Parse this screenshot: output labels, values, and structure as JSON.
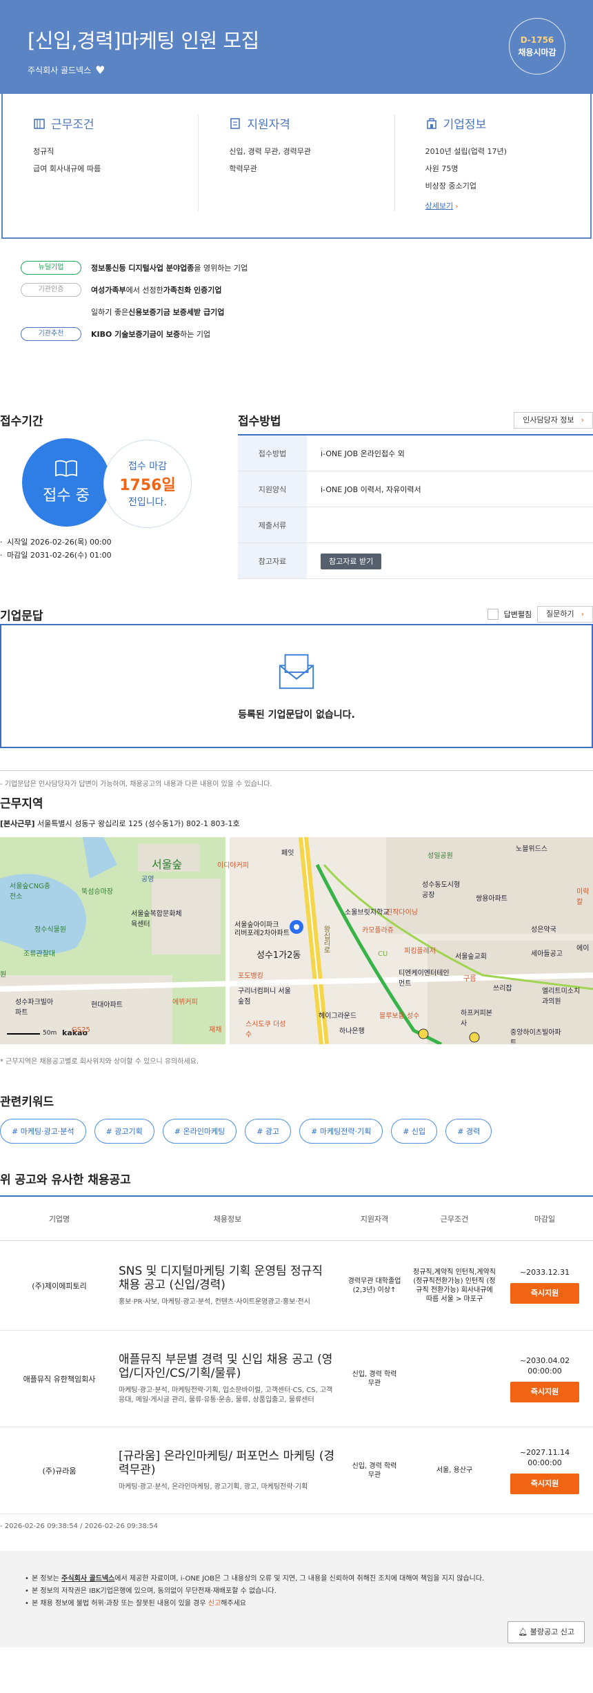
{
  "header": {
    "title": "[신입,경력]마케팅 인원 모집",
    "company": "주식회사 골드넥스",
    "dday": "D-1756",
    "dday_label": "채용시마감"
  },
  "info": {
    "conditions": {
      "title": "근무조건",
      "lines": [
        "정규직",
        "급여 회사내규에 따름"
      ]
    },
    "qualifications": {
      "title": "지원자격",
      "lines": [
        "신입, 경력 무관, 경력무관",
        "학력무관"
      ]
    },
    "company": {
      "title": "기업정보",
      "lines": [
        "2010년 설립(업력 17년)",
        "사원 75명",
        "비상장 중소기업"
      ],
      "link": "상세보기"
    }
  },
  "tags": [
    {
      "pill": "뉴딜기업",
      "bold": "정보통신등 디지털사업 분야업종",
      "rest": "을 영위하는 기업"
    },
    {
      "pill": "기관인증",
      "bold": "여성가족부",
      "mid": "에서 선정한 ",
      "bold2": "가족친화 인증기업"
    },
    {
      "pill": "",
      "pre": "일하기 좋은 ",
      "bold": "신용보증기금 보증세받 급기업"
    },
    {
      "pill": "기관추천",
      "bold": "KIBO 기술보증기금이 보증",
      "rest": "하는 기업"
    }
  ],
  "apply_period": {
    "title": "접수기간",
    "status": "접수 중",
    "deadline_label": "접수 마감",
    "days": "1756일",
    "before": "전입니다.",
    "start": "시작일 2026-02-26(목) 00:00",
    "end": "마감일 2031-02-26(수) 01:00"
  },
  "apply_method": {
    "title": "접수방법",
    "contact_button": "인사담당자 정보",
    "rows": [
      {
        "k": "접수방법",
        "v": "i-ONE JOB 온라인접수 외"
      },
      {
        "k": "지원양식",
        "v": "i-ONE JOB 이력서, 자유이력서"
      },
      {
        "k": "제출서류",
        "v": ""
      },
      {
        "k": "참고자료",
        "v": "참고자료 받기"
      }
    ]
  },
  "qna": {
    "title": "기업문답",
    "answered_label": "답변펼침",
    "ask_button": "질문하기",
    "empty": "등록된 기업문답이 없습니다.",
    "note": "- 기업문답은 인사담당자가 답변이 가능하며, 채용공고의 내용과 다른 내용이 있을 수 있습니다."
  },
  "location": {
    "title": "근무지역",
    "branch": "[본사근무]",
    "address": " 서울특별시 성동구 왕십리로 125 (성수동1가) 802-1 803-1호",
    "note": "* 근무지역은 채용공고별로 회사위치와 상이할 수 있으니 유의하세요.",
    "map_labels": {
      "place1": "서울숲아이파크",
      "place1b": "리버포레2차아파트",
      "place2": "성수1가2동",
      "scale": "50m",
      "brand": "kakao",
      "l1": "이디야커피",
      "l2": "성일공원",
      "l3": "서울숲",
      "l4": "정수식물원",
      "l5": "소울브릿지학교",
      "l6": "진작다이닝",
      "l7": "카모플라쥬",
      "l8": "피킹플레저",
      "l9": "서울숲교회",
      "l10": "티엔케이엔터테인먼트",
      "l11": "구름",
      "l12": "쓰리잡",
      "l13": "성수동도시형공장",
      "l14": "쌍용아파트",
      "l15": "세아들공고",
      "l16": "성은약국",
      "l17": "포도뱅킹",
      "l18": "구리너컴퍼니 서울숲점",
      "l19": "에뷔커피",
      "l20": "헤이그라운드",
      "l21": "하나은행",
      "l22": "블루보틀 성수",
      "l23": "하프커피본사",
      "l24": "중앙하이츠빌아파트",
      "l25": "현대아파트",
      "l26": "성수파크빌아파트",
      "l27": "GS25",
      "l28": "스시도쿠 더성수",
      "l29": "재채",
      "l30": "공영",
      "l31": "뚝섬승마장",
      "l32": "서울숲CNG충전소",
      "l33": "조류관찰대",
      "l34": "원",
      "l35": "페잇",
      "l36": "노블위드스",
      "l37": "서울숲복합문화체육센터",
      "l38": "CU",
      "l39": "미락칼",
      "l40": "에이",
      "l41": "엘리트미소치과의원",
      "l42": "왕십리로"
    }
  },
  "keywords": {
    "title": "관련키워드",
    "items": [
      "# 마케팅·광고·분석",
      "# 광고기획",
      "# 온라인마케팅",
      "# 광고",
      "# 마케팅전략·기획",
      "# 신입",
      "# 경력"
    ]
  },
  "similar": {
    "title": "위 공고와 유사한 채용공고",
    "headers": [
      "기업명",
      "채용정보",
      "지원자격",
      "근무조건",
      "마감일"
    ],
    "rows": [
      {
        "company": "(주)제이에피토리",
        "title": "SNS 및 디지털마케팅 기획 운영팀 정규직 채용 공고 (신입/경력)",
        "desc": "홍보·PR·사보, 마케팅·광고·분석, 컨텐츠·사이트운영광고·홍보·전시",
        "qual": "경력무관 대학졸업(2,3년) 이상↑",
        "cond": "정규직,계약직 인턴직,계약직 (정규직전환가능) 인턴직 (정규직 전환가능) 회사내규에 따름 서울 > 마포구",
        "deadline": "~2033.12.31",
        "button": "즉시지원"
      },
      {
        "company": "애플뮤직 유한책임회사",
        "title": "애플뮤직 부문별 경력 및 신입 채용 공고 (영업/디자인/CS/기획/물류)",
        "desc": "마케팅·광고·분석, 마케팅전략·기획, 입소문바이럴, 고객센터·CS, CS, 고객응대, 메일·게시글 관리, 물류·유통·운송, 물류, 상품입출고, 물류센터",
        "qual": "신입, 경력 학력무관",
        "cond": "",
        "deadline": "~2030.04.02 00:00:00",
        "button": "즉시지원"
      },
      {
        "company": "(주)규라움",
        "title": "[규라움] 온라인마케팅/ 퍼포먼스 마케팅 (경력무관)",
        "desc": "마케팅·광고·분석, 온라인마케팅, 광고기획, 광고, 마케팅전략·기획",
        "qual": "신입, 경력 학력무관",
        "cond": "서울, 용산구",
        "deadline": "~2027.11.14 00:00:00",
        "button": "즉시지원"
      }
    ]
  },
  "timestamps": "- 2026-02-26 09:38:54 / 2026-02-26 09:38:54",
  "footer": {
    "line1_pre": "본 정보는 ",
    "line1_company": "주식회사 골드넥스",
    "line1_post": "에서 제공한 자료이며, i-ONE JOB은 그 내용상의 오류 및 지연, 그 내용을 신뢰하여 취해진 조치에 대해여 책임을 지지 않습니다.",
    "line2": "본 정보의 저작권은 IBK기업은행에 있으며, 동의없이 무단전재·재배포할 수 없습니다.",
    "line3_pre": "본 채용 정보에 불법 허위·과장 또는 잘못된 내용이 있을 경우 ",
    "line3_link": "신고",
    "line3_post": "해주세요",
    "report_button": "불량공고 신고"
  },
  "colors": {
    "brand": "#5b84c4",
    "accent": "#f06414",
    "blue": "#2f7ee6"
  }
}
